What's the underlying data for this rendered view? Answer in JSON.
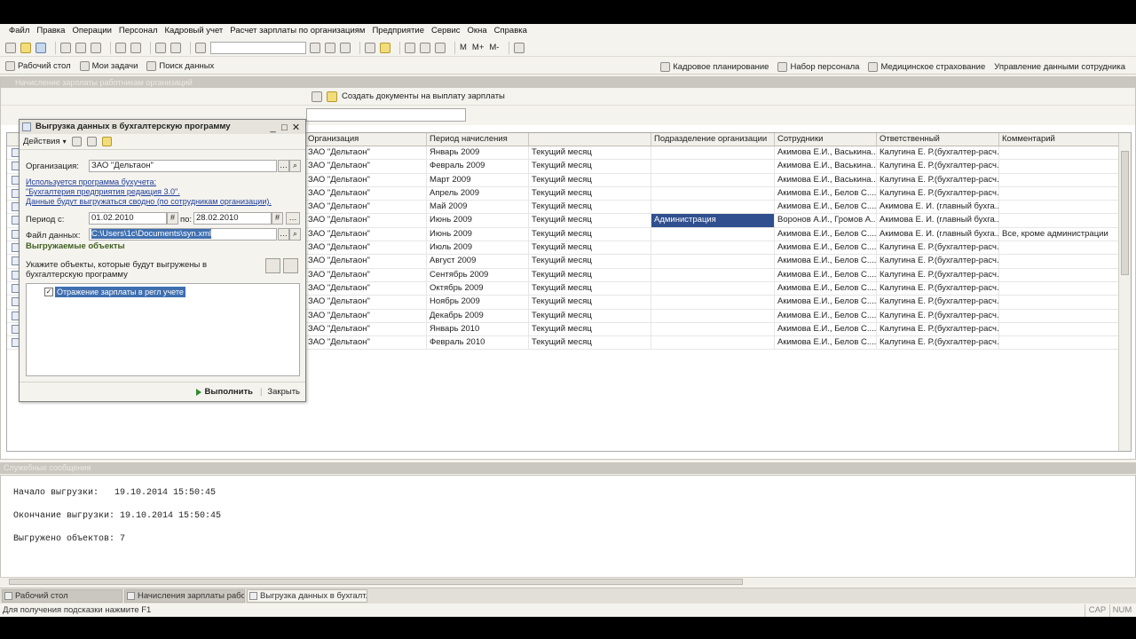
{
  "menu": [
    "Файл",
    "Правка",
    "Операции",
    "Персонал",
    "Кадровый учет",
    "Расчет зарплаты по организациям",
    "Предприятие",
    "Сервис",
    "Окна",
    "Справка"
  ],
  "toolbar": {
    "m": "M",
    "mplus": "M+",
    "mminus": "M-"
  },
  "panel": {
    "left": [
      "Рабочий стол",
      "Мои задачи",
      "Поиск данных"
    ],
    "right": [
      "Кадровое планирование",
      "Набор персонала",
      "Медицинское страхование",
      "Управление данными сотрудника"
    ]
  },
  "docwin": {
    "title": "Начисление зарплаты работникам организаций",
    "create_payment_docs": "Создать документы на выплату зарплаты",
    "columns": [
      "Организация",
      "Период начисления",
      "",
      "Подразделение организации",
      "Сотрудники",
      "Ответственный",
      "Комментарий"
    ],
    "rows": [
      {
        "org": "ЗАО \"Дельтаон\"",
        "period": "Январь 2009",
        "month": "Текущий месяц",
        "dept": "",
        "emp": "Акимова Е.И., Васькина...",
        "resp": "Калугина Е. Р.(бухгалтер-расч...",
        "comment": ""
      },
      {
        "org": "ЗАО \"Дельтаон\"",
        "period": "Февраль 2009",
        "month": "Текущий месяц",
        "dept": "",
        "emp": "Акимова Е.И., Васькина...",
        "resp": "Калугина Е. Р.(бухгалтер-расч...",
        "comment": ""
      },
      {
        "org": "ЗАО \"Дельтаон\"",
        "period": "Март 2009",
        "month": "Текущий месяц",
        "dept": "",
        "emp": "Акимова Е.И., Васькина...",
        "resp": "Калугина Е. Р.(бухгалтер-расч...",
        "comment": ""
      },
      {
        "org": "ЗАО \"Дельтаон\"",
        "period": "Апрель 2009",
        "month": "Текущий месяц",
        "dept": "",
        "emp": "Акимова Е.И., Белов С....",
        "resp": "Калугина Е. Р.(бухгалтер-расч...",
        "comment": ""
      },
      {
        "org": "ЗАО \"Дельтаон\"",
        "period": "Май 2009",
        "month": "Текущий месяц",
        "dept": "",
        "emp": "Акимова Е.И., Белов С....",
        "resp": "Акимова Е. И. (главный бухга...",
        "comment": ""
      },
      {
        "org": "ЗАО \"Дельтаон\"",
        "period": "Июнь 2009",
        "month": "Текущий месяц",
        "dept": "Администрация",
        "emp": "Воронов А.И., Громов А....",
        "resp": "Акимова Е. И. (главный бухга...",
        "comment": ""
      },
      {
        "org": "ЗАО \"Дельтаон\"",
        "period": "Июнь 2009",
        "month": "Текущий месяц",
        "dept": "",
        "emp": "Акимова Е.И., Белов С....",
        "resp": "Акимова Е. И. (главный бухга...",
        "comment": "Все, кроме администрации"
      },
      {
        "org": "ЗАО \"Дельтаон\"",
        "period": "Июль 2009",
        "month": "Текущий месяц",
        "dept": "",
        "emp": "Акимова Е.И., Белов С....",
        "resp": "Калугина Е. Р.(бухгалтер-расч...",
        "comment": ""
      },
      {
        "org": "ЗАО \"Дельтаон\"",
        "period": "Август 2009",
        "month": "Текущий месяц",
        "dept": "",
        "emp": "Акимова Е.И., Белов С....",
        "resp": "Калугина Е. Р.(бухгалтер-расч...",
        "comment": ""
      },
      {
        "org": "ЗАО \"Дельтаон\"",
        "period": "Сентябрь 2009",
        "month": "Текущий месяц",
        "dept": "",
        "emp": "Акимова Е.И., Белов С....",
        "resp": "Калугина Е. Р.(бухгалтер-расч...",
        "comment": ""
      },
      {
        "org": "ЗАО \"Дельтаон\"",
        "period": "Октябрь 2009",
        "month": "Текущий месяц",
        "dept": "",
        "emp": "Акимова Е.И., Белов С....",
        "resp": "Калугина Е. Р.(бухгалтер-расч...",
        "comment": ""
      },
      {
        "org": "ЗАО \"Дельтаон\"",
        "period": "Ноябрь 2009",
        "month": "Текущий месяц",
        "dept": "",
        "emp": "Акимова Е.И., Белов С....",
        "resp": "Калугина Е. Р.(бухгалтер-расч...",
        "comment": ""
      },
      {
        "org": "ЗАО \"Дельтаон\"",
        "period": "Декабрь 2009",
        "month": "Текущий месяц",
        "dept": "",
        "emp": "Акимова Е.И., Белов С....",
        "resp": "Калугина Е. Р.(бухгалтер-расч...",
        "comment": ""
      },
      {
        "org": "ЗАО \"Дельтаон\"",
        "period": "Январь 2010",
        "month": "Текущий месяц",
        "dept": "",
        "emp": "Акимова Е.И., Белов С....",
        "resp": "Калугина Е. Р.(бухгалтер-расч...",
        "comment": ""
      },
      {
        "org": "ЗАО \"Дельтаон\"",
        "period": "Февраль 2010",
        "month": "Текущий месяц",
        "dept": "",
        "emp": "Акимова Е.И., Белов С....",
        "resp": "Калугина Е. Р.(бухгалтер-расч...",
        "comment": ""
      }
    ]
  },
  "dialog": {
    "title": "Выгрузка данных в бухгалтерскую программу",
    "actions": "Действия",
    "org_label": "Организация:",
    "org_value": "ЗАО \"Дельтаон\"",
    "link1": "Используется программа бухучета:",
    "link2": "\"Бухгалтерия предприятия редакция 3.0\".",
    "link3": "Данные будут выгружаться сводно (по сотрудникам организации).",
    "period_label": "Период с:",
    "period_from": "01.02.2010",
    "period_to_label": "по:",
    "period_to": "28.02.2010",
    "file_label": "Файл данных:",
    "file_value": "C:\\Users\\1c\\Documents\\syn.xml",
    "section": "Выгружаемые объекты",
    "hint": "Укажите объекты, которые будут выгружены в бухгалтерскую программу",
    "object": "Отражение зарплаты в регл учете",
    "run": "Выполнить",
    "close": "Закрыть"
  },
  "messages": {
    "title": "Служебные сообщения",
    "start": "Начало выгрузки:   19.10.2014 15:50:45",
    "end": "Окончание выгрузки: 19.10.2014 15:50:45",
    "count": "Выгружено объектов: 7"
  },
  "taskbar": [
    "Рабочий стол",
    "Начисления зарплаты рабо...",
    "Выгрузка данных в бухгалт..."
  ],
  "status": {
    "hint": "Для получения подсказки нажмите F1",
    "cap": "CAP",
    "num": "NUM"
  }
}
